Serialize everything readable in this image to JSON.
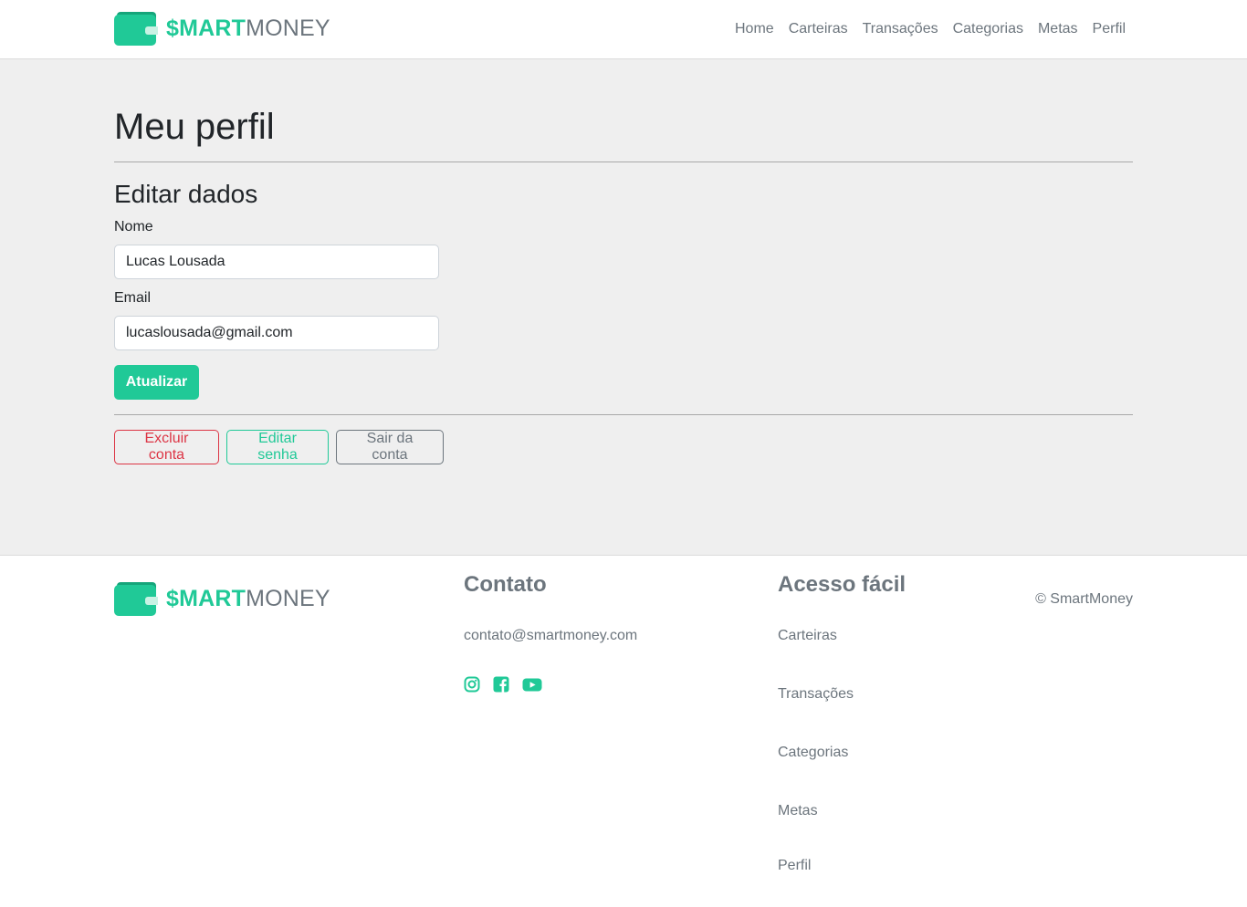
{
  "brand": {
    "bold": "$MART",
    "light": "MONEY",
    "accent": "#20c997"
  },
  "nav": [
    {
      "label": "Home"
    },
    {
      "label": "Carteiras"
    },
    {
      "label": "Transações"
    },
    {
      "label": "Categorias"
    },
    {
      "label": "Metas"
    },
    {
      "label": "Perfil"
    }
  ],
  "main": {
    "title": "Meu perfil",
    "section_title": "Editar dados",
    "name_label": "Nome",
    "name_value": "Lucas Lousada",
    "email_label": "Email",
    "email_value": "lucaslousada@gmail.com",
    "update_button": "Atualizar",
    "delete_button": "Excluir conta",
    "edit_password_button": "Editar senha",
    "logout_button": "Sair da conta"
  },
  "footer": {
    "contact_heading": "Contato",
    "contact_email": "contato@smartmoney.com",
    "social_icons": [
      "instagram-icon",
      "facebook-icon",
      "youtube-icon"
    ],
    "quick_heading": "Acesso fácil",
    "quick_links": [
      {
        "label": "Carteiras"
      },
      {
        "label": "Transações"
      },
      {
        "label": "Categorias"
      },
      {
        "label": "Metas"
      },
      {
        "label": "Perfil"
      }
    ],
    "copyright": "© SmartMoney"
  },
  "colors": {
    "danger": "#dc3545",
    "success": "#20c997",
    "secondary": "#6c757d",
    "main_bg": "#efefef"
  }
}
